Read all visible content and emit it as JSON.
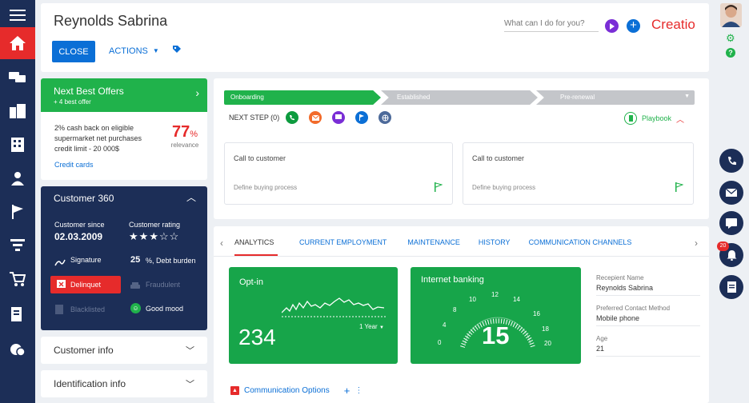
{
  "header": {
    "title": "Reynolds Sabrina",
    "close_label": "CLOSE",
    "actions_label": "ACTIONS",
    "search_placeholder": "What can I do for you?",
    "brand": "Creatio"
  },
  "nbo": {
    "title": "Next Best Offers",
    "subtitle": "+ 4 best offer",
    "offer_text": "2% cash back on eligible supermarket net purchases credit limit - 20 000$",
    "percent": "77",
    "percent_sign": "%",
    "relevance": "relevance",
    "link": "Credit cards"
  },
  "c360": {
    "title": "Customer 360",
    "since_label": "Customer since",
    "since_value": "02.03.2009",
    "rating_label": "Customer rating",
    "rating": 3,
    "signature": "Signature",
    "debt_value": "25",
    "debt_label": "%, Debt burden",
    "delinquet": "Delinquet",
    "fraudulent": "Fraudulent",
    "blacklisted": "Blacklisted",
    "mood": "Good mood"
  },
  "collapsed": {
    "customer_info": "Customer info",
    "identification_info": "Identification info"
  },
  "stages": [
    "Onboarding",
    "Established",
    "Pre-renewal"
  ],
  "next_step": {
    "label": "NEXT STEP (0)",
    "playbook": "Playbook"
  },
  "tasks": [
    {
      "title": "Call to customer",
      "sub": "Define buying process"
    },
    {
      "title": "Call to customer",
      "sub": "Define buying process"
    }
  ],
  "tabs": [
    "ANALYTICS",
    "CURRENT EMPLOYMENT",
    "MAINTENANCE",
    "HISTORY",
    "COMMUNICATION CHANNELS"
  ],
  "optin": {
    "title": "Opt-in",
    "value": "234",
    "period": "1 Year"
  },
  "banking": {
    "title": "Internet banking",
    "value": "15",
    "ticks": [
      "0",
      "4",
      "8",
      "10",
      "12",
      "14",
      "16",
      "18",
      "20"
    ]
  },
  "details": [
    {
      "label": "Recepient Name",
      "value": "Reynolds Sabrina"
    },
    {
      "label": "Preferred Contact Method",
      "value": "Mobile phone"
    },
    {
      "label": "Age",
      "value": "21"
    }
  ],
  "comm_options": "Communication Options",
  "notifications_count": "20",
  "colors": {
    "navy": "#1c2e57",
    "red": "#e62b2b",
    "green": "#20b24b",
    "blue": "#0b6fd6"
  }
}
